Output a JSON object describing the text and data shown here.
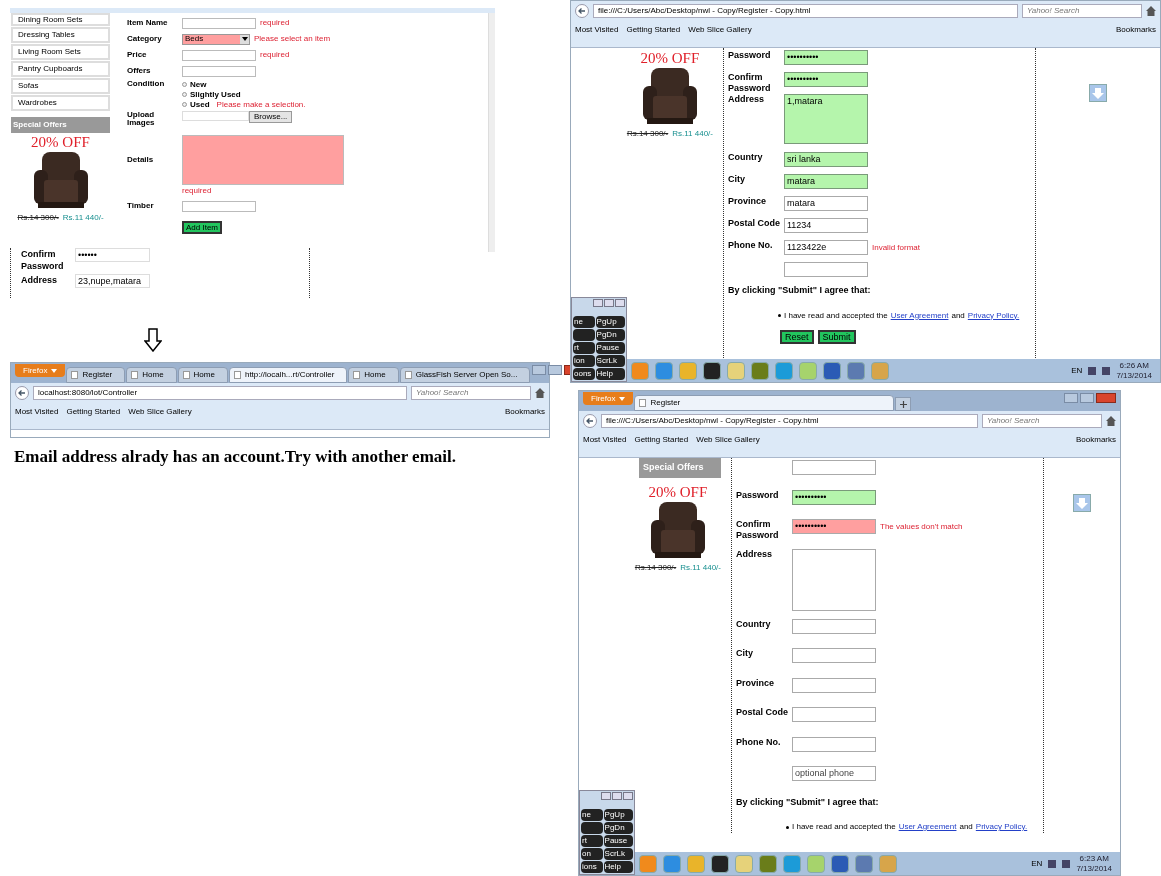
{
  "admin_page": {
    "sidebar_items": [
      "Dining Room Sets",
      "Dressing Tables",
      "Living Room Sets",
      "Pantry Cupboards",
      "Sofas",
      "Wardrobes"
    ],
    "offer": {
      "heading": "Special Offers",
      "discount": "20% OFF",
      "old_price": "Rs.14 300/-",
      "new_price": "Rs.11 440/-"
    },
    "fields": [
      {
        "kind": "input",
        "label": "Item Name",
        "invalid": false,
        "error": "required"
      },
      {
        "kind": "select",
        "label": "Category",
        "value": "Beds",
        "invalid": true,
        "error": "Please select an item"
      },
      {
        "kind": "input",
        "label": "Price",
        "invalid": false,
        "error": "required"
      },
      {
        "kind": "input",
        "label": "Offers",
        "invalid": false
      },
      {
        "kind": "radio",
        "label": "Condition",
        "options": [
          {
            "label": "New",
            "selected": false
          },
          {
            "label": "Slightly Used",
            "selected": false
          },
          {
            "label": "Used",
            "selected": false
          }
        ],
        "error": "Please make a selection."
      },
      {
        "kind": "file",
        "label": "Upload Images",
        "button": "Browse..."
      },
      {
        "kind": "textarea",
        "label": "Details",
        "invalid": true,
        "error": "required"
      },
      {
        "kind": "input",
        "label": "Timber",
        "invalid": false
      }
    ],
    "submit": "Add Item"
  },
  "fragment": {
    "rows": [
      {
        "label": "Confirm Password",
        "value": "••••••"
      },
      {
        "label": "Address",
        "value": "23,nupe,matara"
      }
    ]
  },
  "controller_window": {
    "menu_label": "Firefox",
    "tabs": [
      {
        "title": "Register",
        "selected": false
      },
      {
        "title": "Home",
        "selected": false
      },
      {
        "title": "Home",
        "selected": false
      },
      {
        "title": "http://localh...rt/Controller",
        "selected": true
      },
      {
        "title": "Home",
        "selected": false
      },
      {
        "title": "GlassFish Server Open So...",
        "selected": false
      }
    ],
    "url": "localhost:8080/lot/Controller",
    "search_placeholder": "Yahoo! Search",
    "bookmarks": [
      "Most Visited",
      "Getting Started",
      "Web Slice Gallery"
    ],
    "bookmarks_menu": "Bookmarks",
    "message": "Email address alrady has an account.Try with another email."
  },
  "register_filled": {
    "url": "file:///C:/Users/Abc/Desktop/nwl - Copy/Register - Copy.html",
    "search_placeholder": "Yahoo! Search",
    "bookmarks": [
      "Most Visited",
      "Getting Started",
      "Web Slice Gallery"
    ],
    "bookmarks_menu": "Bookmarks",
    "offer": {
      "discount": "20% OFF",
      "old_price": "Rs.14 300/-",
      "new_price": "Rs.11 440/-"
    },
    "fields": [
      {
        "kind": "input",
        "label": "Password",
        "value": "••••••••••",
        "valid": true,
        "invalid": false
      },
      {
        "kind": "input",
        "label": "Confirm Password",
        "value": "••••••••••",
        "valid": true,
        "invalid": false
      },
      {
        "kind": "textarea",
        "label": "Address",
        "value": "1,matara",
        "valid": true,
        "invalid": false
      },
      {
        "kind": "input",
        "label": "Country",
        "value": "sri lanka",
        "valid": true,
        "invalid": false
      },
      {
        "kind": "input",
        "label": "City",
        "value": "matara",
        "valid": true,
        "invalid": false
      },
      {
        "kind": "input",
        "label": "Province",
        "value": "matara",
        "valid": false,
        "invalid": false
      },
      {
        "kind": "input",
        "label": "Postal Code",
        "value": "11234",
        "valid": false,
        "invalid": false
      },
      {
        "kind": "input",
        "label": "Phone No.",
        "value": "1123422e",
        "valid": false,
        "invalid": false,
        "error": "Invalid format"
      },
      {
        "kind": "input",
        "valid": false,
        "invalid": false
      }
    ],
    "agreement": {
      "heading": "By clicking \"Submit\" I agree that:",
      "text": "I have read and accepted the",
      "link_1": "User Agreement",
      "joiner": "and",
      "link_2": "Privacy Policy."
    },
    "buttons": [
      "Reset",
      "Submit"
    ],
    "keyboard_keys": [
      {
        "left": "ne",
        "right": "PgUp"
      },
      {
        "right": "PgDn"
      },
      {
        "left": "rt",
        "right": "Pause"
      },
      {
        "left": "ion",
        "right": "ScrLk"
      },
      {
        "left": "oons",
        "right": "Help"
      }
    ],
    "tray_language": "EN",
    "clock_time": "6:26 AM",
    "clock_date": "7/13/2014"
  },
  "register_mismatch": {
    "menu_label": "Firefox",
    "tabs": [
      {
        "title": "Register",
        "selected": true
      }
    ],
    "url": "file:///C:/Users/Abc/Desktop/nwl - Copy/Register - Copy.html",
    "search_placeholder": "Yahoo! Search",
    "bookmarks": [
      "Most Visited",
      "Getting Started",
      "Web Slice Gallery"
    ],
    "bookmarks_menu": "Bookmarks",
    "offer": {
      "heading": "Special Offers",
      "discount": "20% OFF",
      "old_price": "Rs.14 300/-",
      "new_price": "Rs.11 440/-"
    },
    "fields": [
      {
        "kind": "input",
        "valid": false,
        "invalid": false
      },
      {
        "kind": "input",
        "label": "Password",
        "value": "••••••••••",
        "valid": true,
        "invalid": false
      },
      {
        "kind": "input",
        "label": "Confirm Password",
        "value": "••••••••••",
        "valid": false,
        "invalid": true,
        "error": "The values don't match"
      },
      {
        "kind": "textarea",
        "label": "Address",
        "valid": false,
        "invalid": false
      },
      {
        "kind": "input",
        "label": "Country",
        "valid": false,
        "invalid": false
      },
      {
        "kind": "input",
        "label": "City",
        "valid": false,
        "invalid": false
      },
      {
        "kind": "input",
        "label": "Province",
        "valid": false,
        "invalid": false
      },
      {
        "kind": "input",
        "label": "Postal Code",
        "valid": false,
        "invalid": false
      },
      {
        "kind": "input",
        "label": "Phone No.",
        "valid": false,
        "invalid": false
      },
      {
        "kind": "input",
        "placeholder": "optional phone",
        "valid": false,
        "invalid": false
      }
    ],
    "agreement": {
      "heading": "By clicking \"Submit\" I agree that:",
      "text": "I have read and accepted the",
      "link_1": "User Agreement",
      "joiner": "and",
      "link_2": "Privacy Policy."
    },
    "keyboard_keys": [
      {
        "left": "ne",
        "right": "PgUp"
      },
      {
        "right": "PgDn"
      },
      {
        "left": "rt",
        "right": "Pause"
      },
      {
        "left": "on",
        "right": "ScrLk"
      },
      {
        "left": "ions",
        "right": "Help"
      }
    ],
    "tray_language": "EN",
    "clock_time": "6:23 AM",
    "clock_date": "7/13/2014"
  }
}
